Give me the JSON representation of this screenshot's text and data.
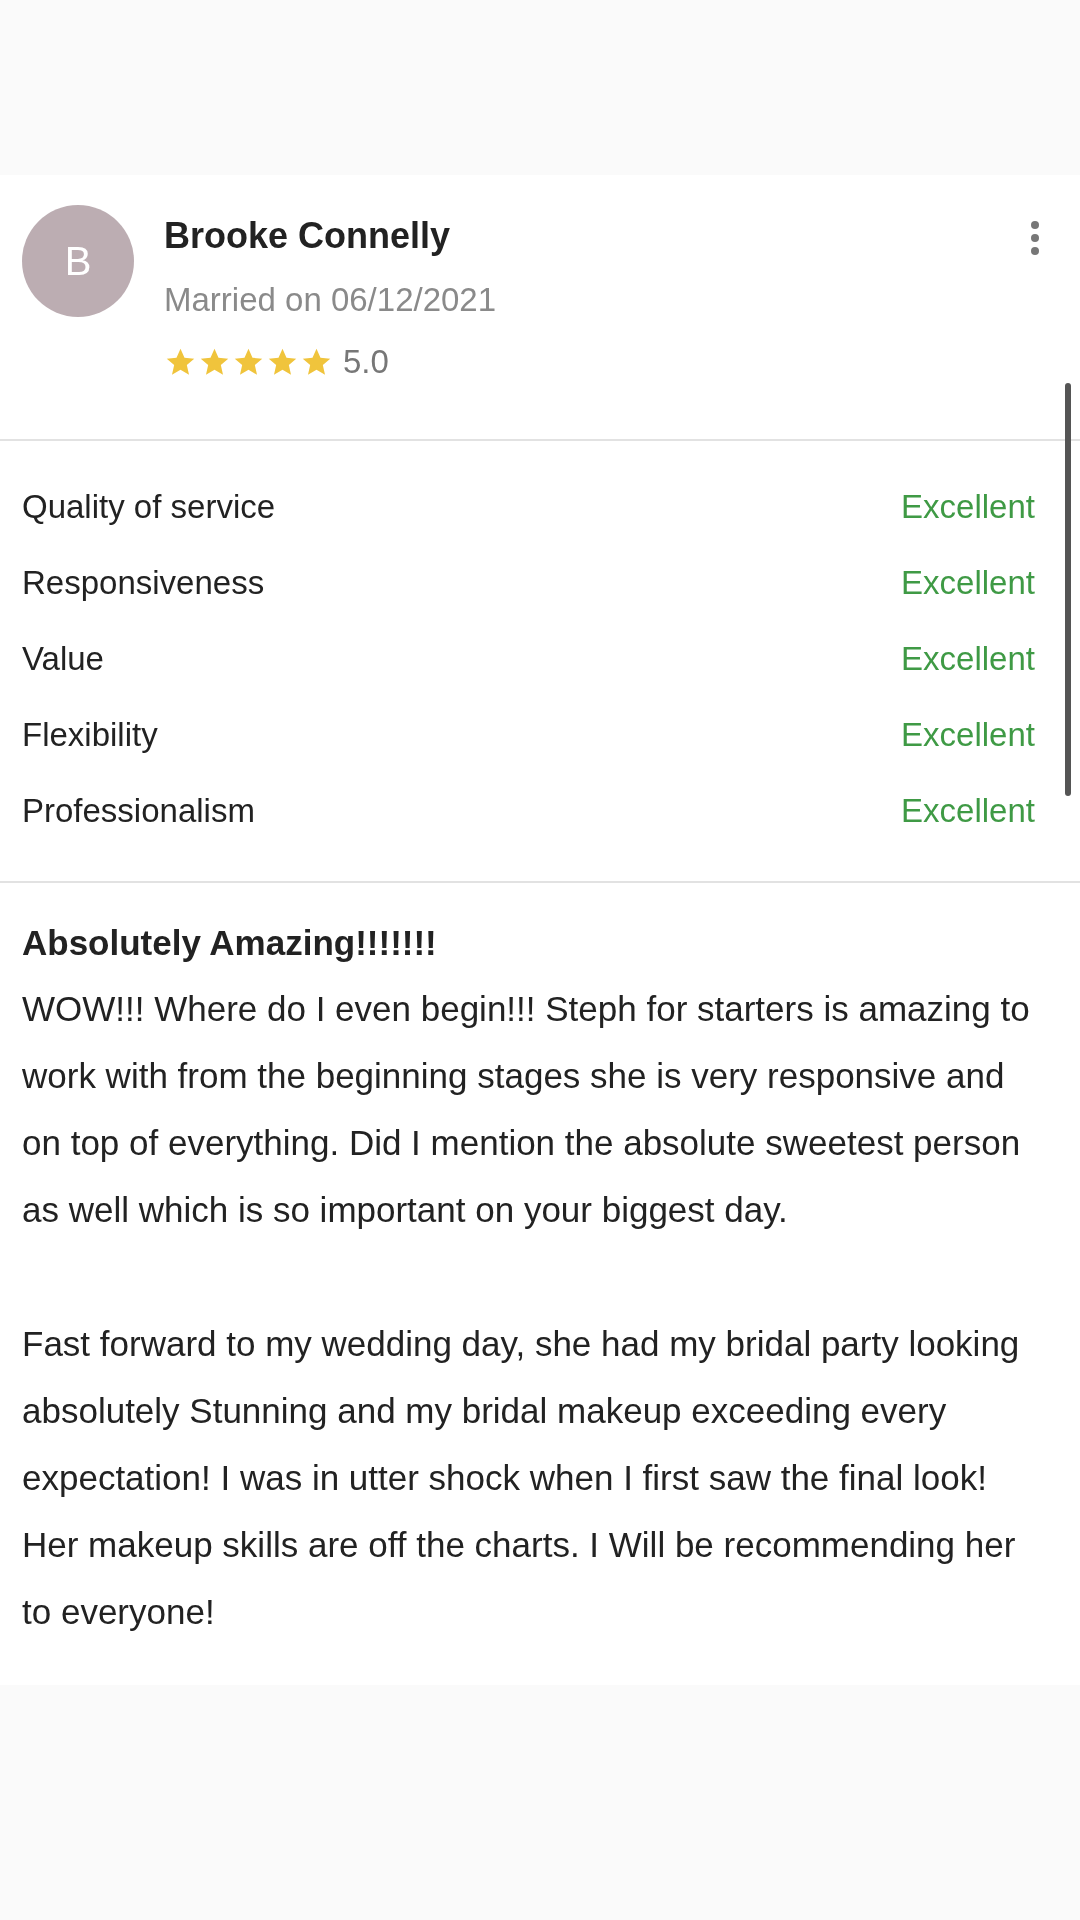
{
  "review": {
    "avatar_initial": "B",
    "name": "Brooke Connelly",
    "married": "Married on 06/12/2021",
    "stars": 5,
    "rating": "5.0"
  },
  "ratings": [
    {
      "label": "Quality of service",
      "value": "Excellent"
    },
    {
      "label": "Responsiveness",
      "value": "Excellent"
    },
    {
      "label": "Value",
      "value": "Excellent"
    },
    {
      "label": "Flexibility",
      "value": "Excellent"
    },
    {
      "label": "Professionalism",
      "value": "Excellent"
    }
  ],
  "title": "Absolutely Amazing!!!!!!!",
  "paragraphs": [
    "WOW!!! Where do I even begin!!! Steph for starters is amazing to work with from the beginning stages she is very responsive and on top of everything. Did I mention the absolute sweetest person as well which is so important on your biggest day.",
    "Fast forward to my wedding day, she had my bridal party looking absolutely Stunning and my bridal makeup exceeding every expectation! I was in utter shock when I first saw the final look! Her makeup skills are off the charts. I Will be recommending her to everyone!"
  ]
}
